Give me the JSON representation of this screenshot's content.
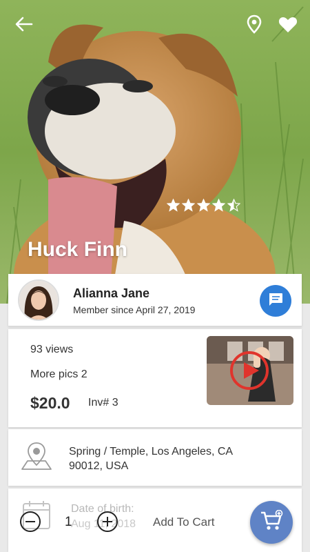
{
  "pet": {
    "name": "Huck Finn",
    "rating": 4.5,
    "rating_max": 5
  },
  "owner": {
    "name": "Alianna Jane",
    "member_since": "Member since April 27, 2019"
  },
  "listing": {
    "views": "93 views",
    "more_pics": "More pics 2",
    "price": "$20.0",
    "inventory": "Inv# 3"
  },
  "location": {
    "address": "Spring / Temple, Los Angeles, CA 90012, USA"
  },
  "dob": {
    "label": "Date of birth:",
    "value": "Aug 11, 2018"
  },
  "cart": {
    "quantity": "1",
    "add_label": "Add To Cart"
  },
  "colors": {
    "accent": "#2f7ed8",
    "cart_fab": "#5f83c6"
  }
}
